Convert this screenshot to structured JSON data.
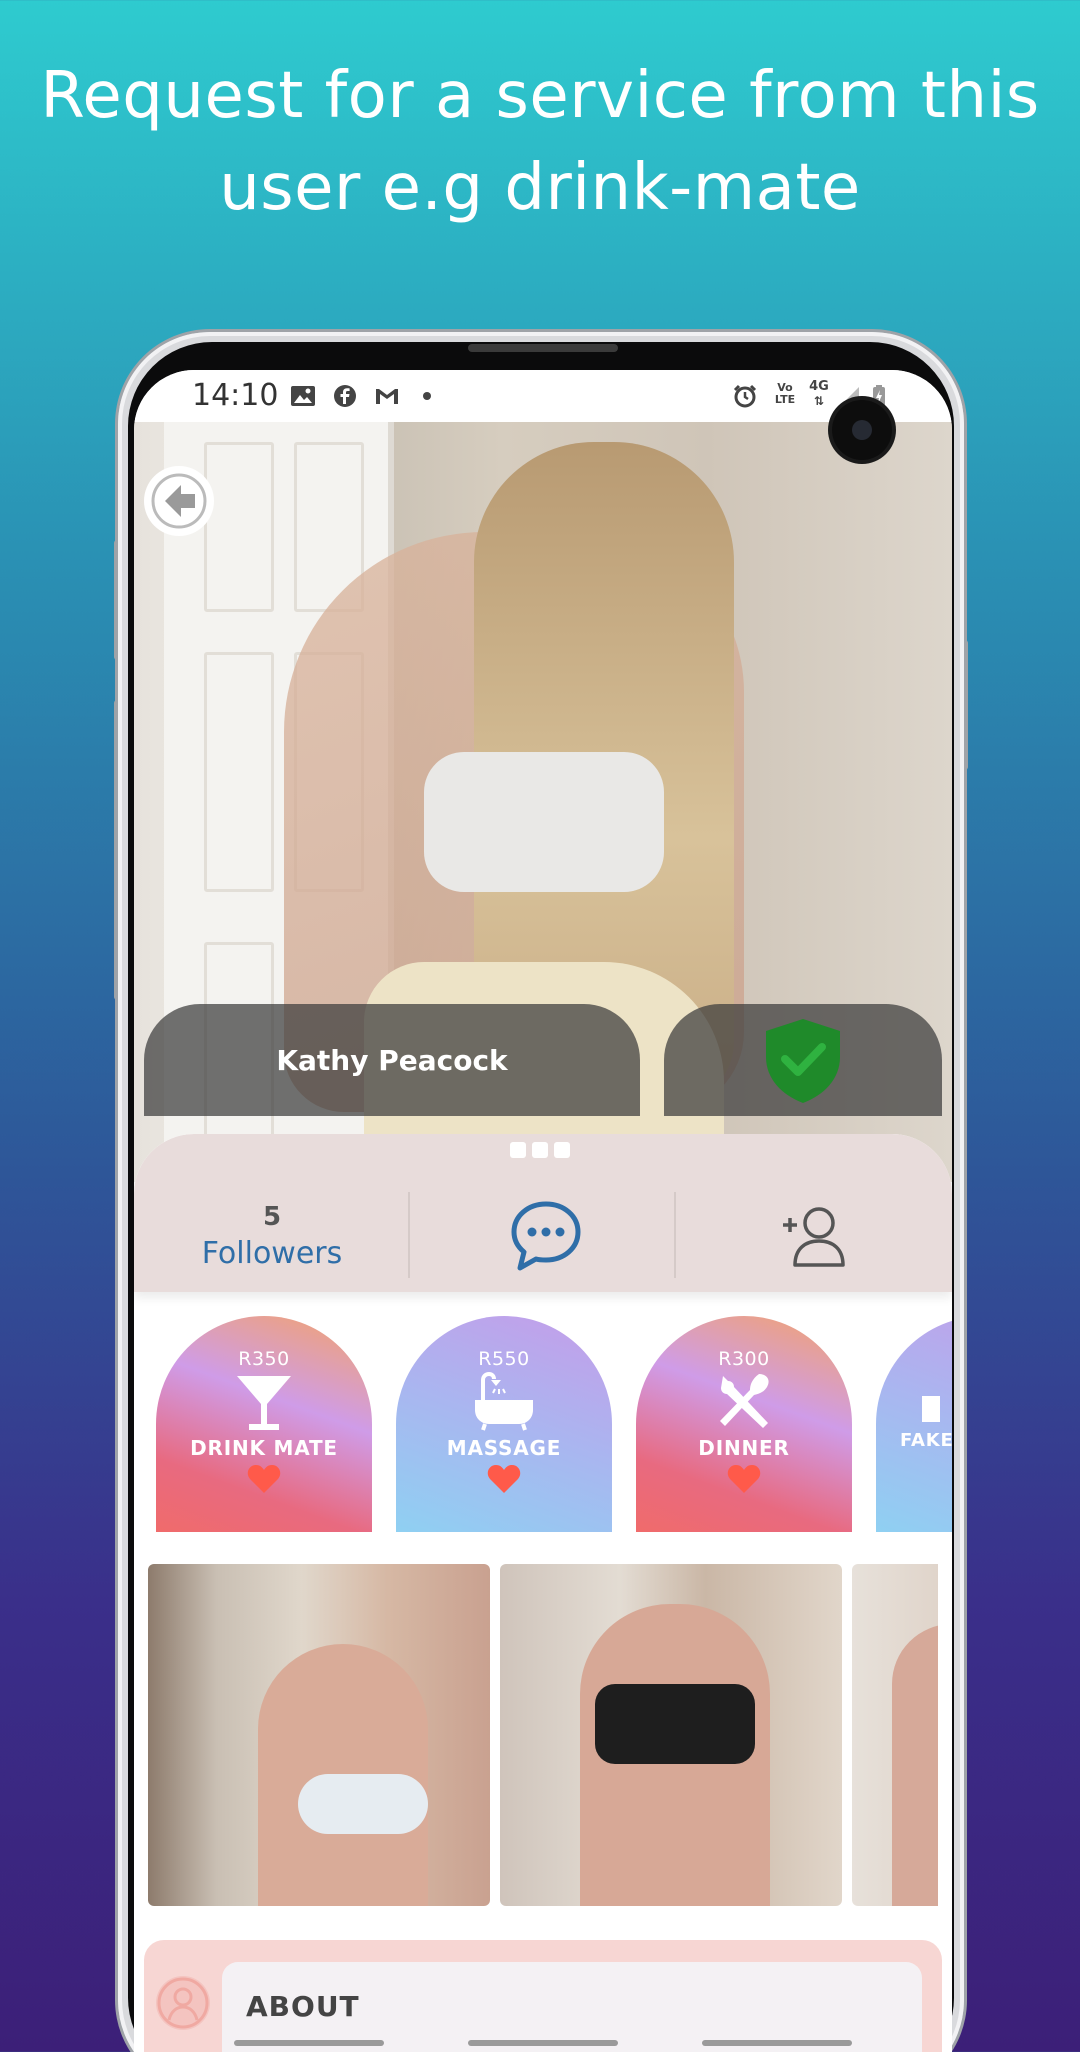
{
  "headline": {
    "line1": "Request for a service from this",
    "line2": "user e.g drink-mate"
  },
  "status_bar": {
    "time": "14:10",
    "left_icons": [
      "image-icon",
      "facebook-icon",
      "gmail-icon",
      "dot-icon"
    ],
    "right_icons": [
      "alarm-icon",
      "volte-icon",
      "4g-icon",
      "signal-icon",
      "battery-icon"
    ],
    "volte_label": "Vo LTE",
    "network_label": "4G"
  },
  "profile": {
    "name": "Kathy Peacock",
    "verified": true
  },
  "stats": {
    "followers_count": "5",
    "followers_label": "Followers"
  },
  "services": [
    {
      "price": "R350",
      "name": "DRINK MATE",
      "icon": "cocktail-icon"
    },
    {
      "price": "R550",
      "name": "MASSAGE",
      "icon": "bathtub-icon"
    },
    {
      "price": "R300",
      "name": "DINNER",
      "icon": "cutlery-icon"
    },
    {
      "price": "",
      "name": "FAKE",
      "icon": "service-icon"
    }
  ],
  "about": {
    "title": "ABOUT"
  },
  "colors": {
    "accent_blue": "#2f6ea8",
    "verified_green": "#1f8a2a",
    "heart": "#ff5a4a"
  }
}
